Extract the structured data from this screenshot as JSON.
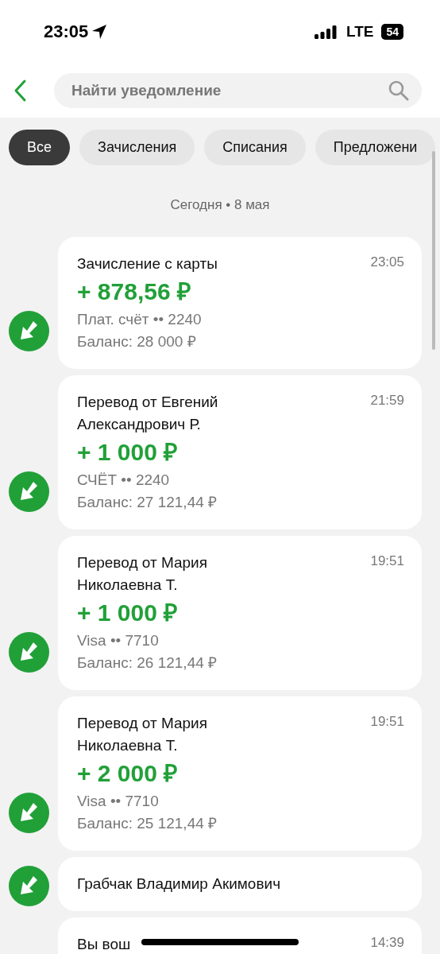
{
  "status_bar": {
    "time": "23:05",
    "network": "LTE",
    "battery": "54"
  },
  "search": {
    "placeholder": "Найти уведомление"
  },
  "filters": [
    {
      "label": "Все",
      "selected": true
    },
    {
      "label": "Зачисления",
      "selected": false
    },
    {
      "label": "Списания",
      "selected": false
    },
    {
      "label": "Предложени",
      "selected": false
    }
  ],
  "date_header": "Сегодня • 8 мая",
  "notifications": [
    {
      "title": "Зачисление с карты",
      "time": "23:05",
      "amount": "+ 878,56 ₽",
      "account": "Плат. счёт •• 2240",
      "balance": "Баланс: 28 000 ₽",
      "incoming_icon": true
    },
    {
      "title": "Перевод от Евгений Александрович Р.",
      "time": "21:59",
      "amount": "+ 1 000 ₽",
      "account": "СЧЁТ •• 2240",
      "balance": "Баланс: 27 121,44 ₽",
      "incoming_icon": true
    },
    {
      "title": "Перевод от Мария Николаевна Т.",
      "time": "19:51",
      "amount": "+ 1 000 ₽",
      "account": "Visa •• 7710",
      "balance": "Баланс: 26 121,44 ₽",
      "incoming_icon": true
    },
    {
      "title": "Перевод от Мария Николаевна Т.",
      "time": "19:51",
      "amount": "+ 2 000 ₽",
      "account": "Visa •• 7710",
      "balance": "Баланс: 25 121,44 ₽",
      "incoming_icon": true
    },
    {
      "title": "Грабчак Владимир Акимович",
      "incoming_icon": true
    },
    {
      "title": "Вы вош",
      "time": "14:39",
      "incoming_icon": false
    }
  ]
}
